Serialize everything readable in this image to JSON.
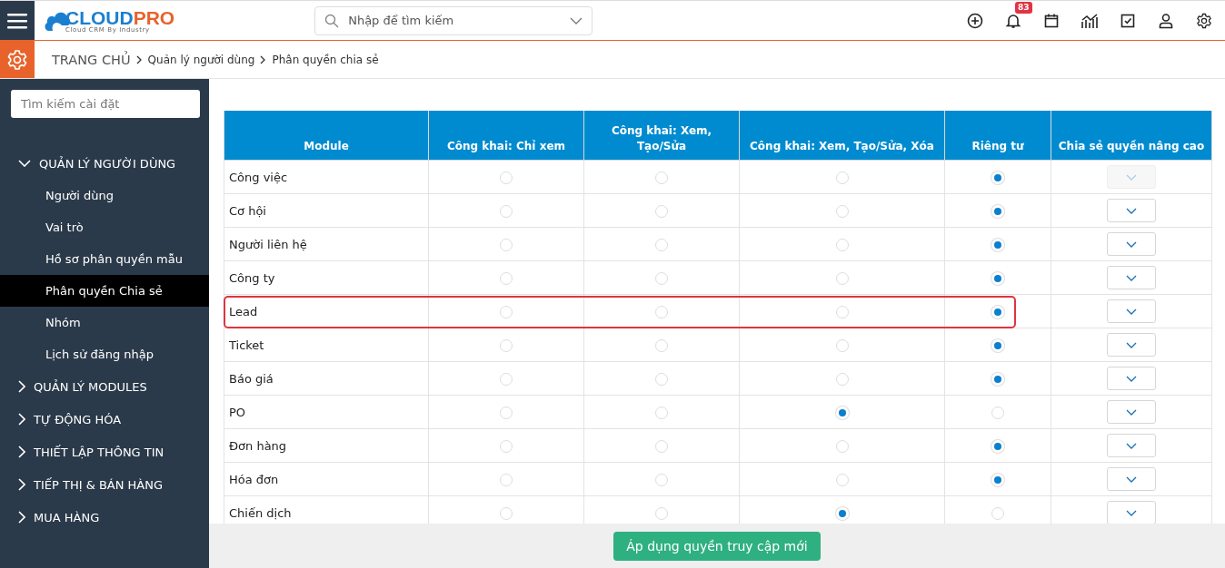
{
  "logo": {
    "first": "CLOUD",
    "second": "PRO",
    "tagline": "Cloud CRM By Industry"
  },
  "search": {
    "placeholder": "Nhập để tìm kiếm"
  },
  "toolbar": {
    "notification_count": "83"
  },
  "breadcrumb": [
    "TRANG CHỦ",
    "Quản lý người dùng",
    "Phân quyền chia sẻ"
  ],
  "sidebar": {
    "search_placeholder": "Tìm kiếm cài đặt",
    "groups": [
      {
        "label": "QUẢN LÝ NGƯỜI DÙNG",
        "expanded": true,
        "children": [
          {
            "label": "Người dùng",
            "selected": false
          },
          {
            "label": "Vai trò",
            "selected": false
          },
          {
            "label": "Hồ sơ phân quyền mẫu",
            "selected": false
          },
          {
            "label": "Phân quyền Chia sẻ",
            "selected": true
          },
          {
            "label": "Nhóm",
            "selected": false
          },
          {
            "label": "Lịch sử đăng nhập",
            "selected": false
          }
        ]
      },
      {
        "label": "QUẢN LÝ MODULES",
        "expanded": false
      },
      {
        "label": "TỰ ĐỘNG HÓA",
        "expanded": false
      },
      {
        "label": "THIẾT LẬP THÔNG TIN",
        "expanded": false
      },
      {
        "label": "TIẾP THỊ & BÁN HÀNG",
        "expanded": false
      },
      {
        "label": "MUA HÀNG",
        "expanded": false
      }
    ]
  },
  "table": {
    "columns": [
      "Module",
      "Công khai: Chỉ xem",
      "Công khai: Xem, Tạo/Sửa",
      "Công khai: Xem, Tạo/Sửa, Xóa",
      "Riêng tư",
      "Chia sẻ quyền nâng cao"
    ],
    "rows": [
      {
        "module": "Công việc",
        "options": [
          false,
          false,
          false,
          true
        ],
        "advanced_disabled": true,
        "highlighted": false
      },
      {
        "module": "Cơ hội",
        "options": [
          false,
          false,
          false,
          true
        ],
        "advanced_disabled": false,
        "highlighted": false
      },
      {
        "module": "Người liên hệ",
        "options": [
          false,
          false,
          false,
          true
        ],
        "advanced_disabled": false,
        "highlighted": false
      },
      {
        "module": "Công ty",
        "options": [
          false,
          false,
          false,
          true
        ],
        "advanced_disabled": false,
        "highlighted": false
      },
      {
        "module": "Lead",
        "options": [
          false,
          false,
          false,
          true
        ],
        "advanced_disabled": false,
        "highlighted": true
      },
      {
        "module": "Ticket",
        "options": [
          false,
          false,
          false,
          true
        ],
        "advanced_disabled": false,
        "highlighted": false
      },
      {
        "module": "Báo giá",
        "options": [
          false,
          false,
          false,
          true
        ],
        "advanced_disabled": false,
        "highlighted": false
      },
      {
        "module": "PO",
        "options": [
          false,
          false,
          true,
          false
        ],
        "advanced_disabled": false,
        "highlighted": false
      },
      {
        "module": "Đơn hàng",
        "options": [
          false,
          false,
          false,
          true
        ],
        "advanced_disabled": false,
        "highlighted": false
      },
      {
        "module": "Hóa đơn",
        "options": [
          false,
          false,
          false,
          true
        ],
        "advanced_disabled": false,
        "highlighted": false
      },
      {
        "module": "Chiến dịch",
        "options": [
          false,
          false,
          true,
          false
        ],
        "advanced_disabled": false,
        "highlighted": false
      }
    ]
  },
  "apply_button": "Áp dụng quyền truy cập mới"
}
